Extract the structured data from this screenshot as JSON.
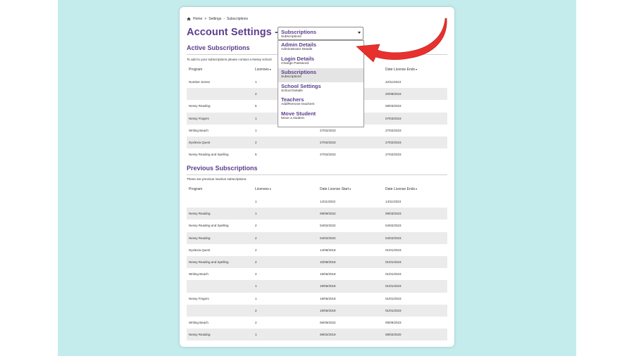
{
  "breadcrumb": [
    "Home",
    "Settings",
    "Subscriptions"
  ],
  "breadcrumb_sep": ">",
  "page_title": "Account Settings -",
  "select": {
    "main": "Subscriptions",
    "sub": "Subscriptions"
  },
  "dropdown": [
    {
      "main": "Admin Details",
      "sub": "Administrator Details",
      "selected": false
    },
    {
      "main": "Login Details",
      "sub": "Change Password",
      "selected": false
    },
    {
      "main": "Subscriptions",
      "sub": "Subscriptions",
      "selected": true
    },
    {
      "main": "School Settings",
      "sub": "School Details",
      "selected": false
    },
    {
      "main": "Teachers",
      "sub": "Add/Remove teachers",
      "selected": false
    },
    {
      "main": "Move Student",
      "sub": "Move a student",
      "selected": false
    }
  ],
  "active": {
    "title": "Active Subscriptions",
    "note": "To add to your subscriptions please contact a Nessy school",
    "headers": [
      "Program",
      "Licenses",
      "",
      "Date License Ends"
    ],
    "rows": [
      [
        "Number Sense",
        "1",
        "",
        "22/11/2023"
      ],
      [
        "",
        "2",
        "",
        "20/08/2023"
      ],
      [
        "Nessy Reading",
        "5",
        "",
        "08/03/2023"
      ],
      [
        "Nessy Fingers",
        "1",
        "",
        "07/03/2023"
      ],
      [
        "Writing Beach",
        "1",
        "27/02/2023",
        "27/02/2023"
      ],
      [
        "Dyslexia Quest",
        "2",
        "27/02/2023",
        "27/02/2023"
      ],
      [
        "Nessy Reading and Spelling",
        "5",
        "27/02/2023",
        "27/02/2023"
      ]
    ]
  },
  "previous": {
    "title": "Previous Subscriptions",
    "note": "These are previous inactive subscriptions.",
    "headers": [
      "Program",
      "Licenses",
      "Date License Start",
      "Date License Ends"
    ],
    "rows": [
      [
        "",
        "1",
        "14/11/2022",
        "14/11/2023"
      ],
      [
        "Nessy Reading",
        "1",
        "09/09/2022",
        "09/03/2023"
      ],
      [
        "Nessy Reading and Spelling",
        "2",
        "04/02/2022",
        "04/02/2023"
      ],
      [
        "Nessy Reading",
        "2",
        "04/02/2022",
        "04/02/2023"
      ],
      [
        "Dyslexia Quest",
        "2",
        "14/08/2018",
        "01/01/2023"
      ],
      [
        "Nessy Reading and Spelling",
        "2",
        "10/08/2018",
        "01/01/2023"
      ],
      [
        "Writing Beach",
        "2",
        "19/06/2018",
        "01/01/2023"
      ],
      [
        "",
        "1",
        "19/06/2018",
        "01/01/2023"
      ],
      [
        "Nessy Fingers",
        "1",
        "19/06/2018",
        "01/01/2023"
      ],
      [
        "",
        "2",
        "19/06/2018",
        "01/01/2023"
      ],
      [
        "Writing Beach",
        "2",
        "06/09/2022",
        "09/09/2023"
      ],
      [
        "Nessy Reading",
        "1",
        "08/02/2019",
        "08/02/2020"
      ]
    ]
  },
  "colors": {
    "accent": "#5b3e8c",
    "arrow": "#e8312f",
    "background": "#c4ecec"
  }
}
